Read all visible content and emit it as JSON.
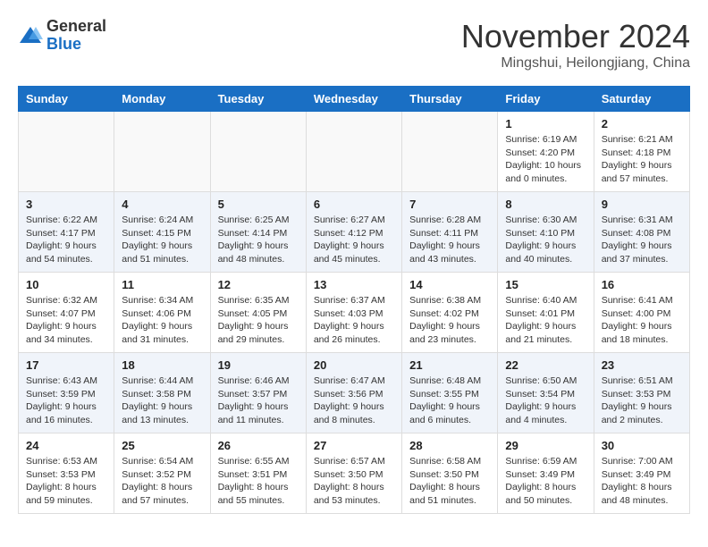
{
  "header": {
    "logo": {
      "general": "General",
      "blue": "Blue"
    },
    "title": "November 2024",
    "location": "Mingshui, Heilongjiang, China"
  },
  "weekdays": [
    "Sunday",
    "Monday",
    "Tuesday",
    "Wednesday",
    "Thursday",
    "Friday",
    "Saturday"
  ],
  "weeks": [
    [
      {
        "day": "",
        "info": ""
      },
      {
        "day": "",
        "info": ""
      },
      {
        "day": "",
        "info": ""
      },
      {
        "day": "",
        "info": ""
      },
      {
        "day": "",
        "info": ""
      },
      {
        "day": "1",
        "info": "Sunrise: 6:19 AM\nSunset: 4:20 PM\nDaylight: 10 hours and 0 minutes."
      },
      {
        "day": "2",
        "info": "Sunrise: 6:21 AM\nSunset: 4:18 PM\nDaylight: 9 hours and 57 minutes."
      }
    ],
    [
      {
        "day": "3",
        "info": "Sunrise: 6:22 AM\nSunset: 4:17 PM\nDaylight: 9 hours and 54 minutes."
      },
      {
        "day": "4",
        "info": "Sunrise: 6:24 AM\nSunset: 4:15 PM\nDaylight: 9 hours and 51 minutes."
      },
      {
        "day": "5",
        "info": "Sunrise: 6:25 AM\nSunset: 4:14 PM\nDaylight: 9 hours and 48 minutes."
      },
      {
        "day": "6",
        "info": "Sunrise: 6:27 AM\nSunset: 4:12 PM\nDaylight: 9 hours and 45 minutes."
      },
      {
        "day": "7",
        "info": "Sunrise: 6:28 AM\nSunset: 4:11 PM\nDaylight: 9 hours and 43 minutes."
      },
      {
        "day": "8",
        "info": "Sunrise: 6:30 AM\nSunset: 4:10 PM\nDaylight: 9 hours and 40 minutes."
      },
      {
        "day": "9",
        "info": "Sunrise: 6:31 AM\nSunset: 4:08 PM\nDaylight: 9 hours and 37 minutes."
      }
    ],
    [
      {
        "day": "10",
        "info": "Sunrise: 6:32 AM\nSunset: 4:07 PM\nDaylight: 9 hours and 34 minutes."
      },
      {
        "day": "11",
        "info": "Sunrise: 6:34 AM\nSunset: 4:06 PM\nDaylight: 9 hours and 31 minutes."
      },
      {
        "day": "12",
        "info": "Sunrise: 6:35 AM\nSunset: 4:05 PM\nDaylight: 9 hours and 29 minutes."
      },
      {
        "day": "13",
        "info": "Sunrise: 6:37 AM\nSunset: 4:03 PM\nDaylight: 9 hours and 26 minutes."
      },
      {
        "day": "14",
        "info": "Sunrise: 6:38 AM\nSunset: 4:02 PM\nDaylight: 9 hours and 23 minutes."
      },
      {
        "day": "15",
        "info": "Sunrise: 6:40 AM\nSunset: 4:01 PM\nDaylight: 9 hours and 21 minutes."
      },
      {
        "day": "16",
        "info": "Sunrise: 6:41 AM\nSunset: 4:00 PM\nDaylight: 9 hours and 18 minutes."
      }
    ],
    [
      {
        "day": "17",
        "info": "Sunrise: 6:43 AM\nSunset: 3:59 PM\nDaylight: 9 hours and 16 minutes."
      },
      {
        "day": "18",
        "info": "Sunrise: 6:44 AM\nSunset: 3:58 PM\nDaylight: 9 hours and 13 minutes."
      },
      {
        "day": "19",
        "info": "Sunrise: 6:46 AM\nSunset: 3:57 PM\nDaylight: 9 hours and 11 minutes."
      },
      {
        "day": "20",
        "info": "Sunrise: 6:47 AM\nSunset: 3:56 PM\nDaylight: 9 hours and 8 minutes."
      },
      {
        "day": "21",
        "info": "Sunrise: 6:48 AM\nSunset: 3:55 PM\nDaylight: 9 hours and 6 minutes."
      },
      {
        "day": "22",
        "info": "Sunrise: 6:50 AM\nSunset: 3:54 PM\nDaylight: 9 hours and 4 minutes."
      },
      {
        "day": "23",
        "info": "Sunrise: 6:51 AM\nSunset: 3:53 PM\nDaylight: 9 hours and 2 minutes."
      }
    ],
    [
      {
        "day": "24",
        "info": "Sunrise: 6:53 AM\nSunset: 3:53 PM\nDaylight: 8 hours and 59 minutes."
      },
      {
        "day": "25",
        "info": "Sunrise: 6:54 AM\nSunset: 3:52 PM\nDaylight: 8 hours and 57 minutes."
      },
      {
        "day": "26",
        "info": "Sunrise: 6:55 AM\nSunset: 3:51 PM\nDaylight: 8 hours and 55 minutes."
      },
      {
        "day": "27",
        "info": "Sunrise: 6:57 AM\nSunset: 3:50 PM\nDaylight: 8 hours and 53 minutes."
      },
      {
        "day": "28",
        "info": "Sunrise: 6:58 AM\nSunset: 3:50 PM\nDaylight: 8 hours and 51 minutes."
      },
      {
        "day": "29",
        "info": "Sunrise: 6:59 AM\nSunset: 3:49 PM\nDaylight: 8 hours and 50 minutes."
      },
      {
        "day": "30",
        "info": "Sunrise: 7:00 AM\nSunset: 3:49 PM\nDaylight: 8 hours and 48 minutes."
      }
    ]
  ]
}
